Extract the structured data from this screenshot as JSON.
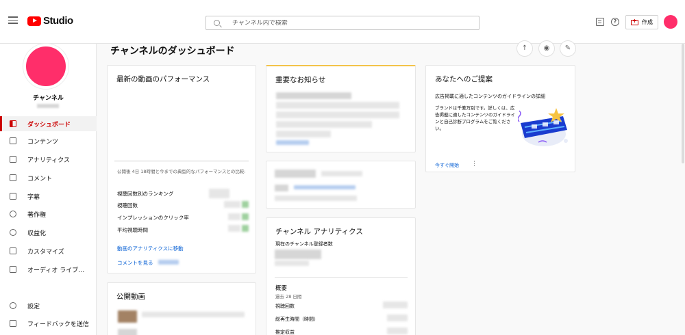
{
  "header": {
    "logo_text": "Studio",
    "search_placeholder": "チャンネル内で検索",
    "create_label": "作成"
  },
  "sidebar": {
    "channel_name": "チャンネル",
    "items": [
      {
        "label": "ダッシュボード",
        "icon": "dashboard-icon",
        "active": true
      },
      {
        "label": "コンテンツ",
        "icon": "content-icon"
      },
      {
        "label": "アナリティクス",
        "icon": "analytics-icon"
      },
      {
        "label": "コメント",
        "icon": "comments-icon"
      },
      {
        "label": "字幕",
        "icon": "subtitles-icon"
      },
      {
        "label": "著作権",
        "icon": "copyright-icon"
      },
      {
        "label": "収益化",
        "icon": "dollar-icon"
      },
      {
        "label": "カスタマイズ",
        "icon": "magic-wand-icon"
      },
      {
        "label": "オーディオ ライブ…",
        "icon": "audio-library-icon"
      }
    ],
    "bottom_items": [
      {
        "label": "設定",
        "icon": "gear-icon"
      },
      {
        "label": "フィードバックを送信",
        "icon": "feedback-icon"
      }
    ]
  },
  "main": {
    "title": "チャンネルのダッシュボード"
  },
  "latest_video": {
    "title": "最新の動画のパフォーマンス",
    "compare_text": "公開後 4日 18時間と今までの典型的なパフォーマンスとの比較:",
    "metrics": [
      "視聴回数別のランキング",
      "視聴回数",
      "インプレッションのクリック率",
      "平均視聴時間"
    ],
    "link_analytics": "動画のアナリティクスに移動",
    "link_comments": "コメントを見る"
  },
  "published": {
    "title": "公開動画"
  },
  "news": {
    "title": "重要なお知らせ"
  },
  "analytics": {
    "title": "チャンネル アナリティクス",
    "subscribers_label": "現在のチャンネル登録者数",
    "summary_title": "概要",
    "summary_period": "過去 28 日間",
    "rows": [
      "視聴回数",
      "総再生時間（時間）",
      "推定収益"
    ]
  },
  "suggestion": {
    "title": "あなたへのご提案",
    "headline": "広告掲載に適したコンテンツのガイドラインの詳細",
    "body": "ブランドは千差万別です。詳しくは、広告掲載に適したコンテンツのガイドラインと自己診断プログラムをご覧ください。",
    "cta": "今すぐ開始",
    "colors": {
      "accent": "#065fd4",
      "brand_red": "#ff0000",
      "avatar": "#ff2e6a"
    }
  }
}
